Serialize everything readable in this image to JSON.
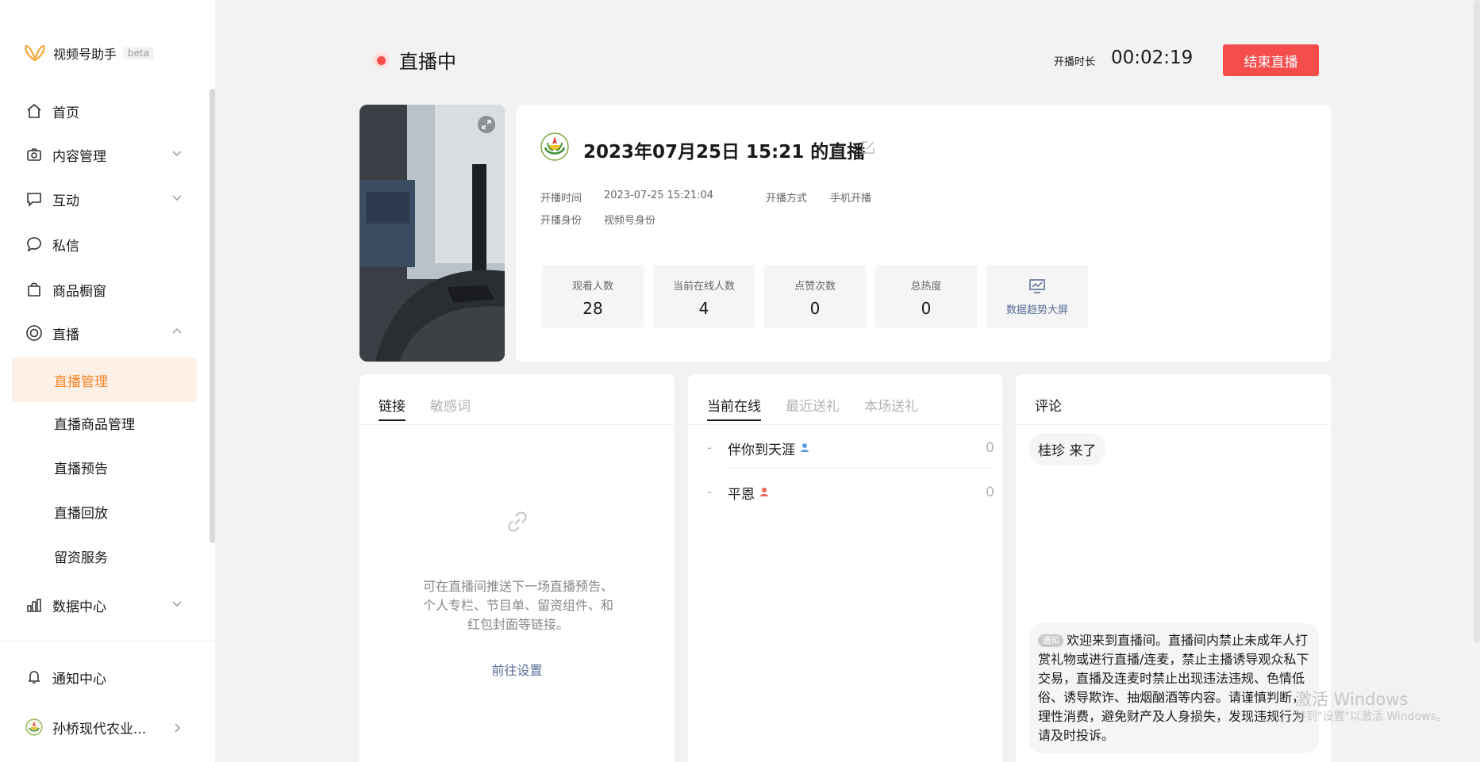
{
  "sidebar": {
    "brand_name": "视频号助手",
    "brand_badge": "beta",
    "items": [
      {
        "label": "首页",
        "icon": "home-icon"
      },
      {
        "label": "内容管理",
        "icon": "camera-icon"
      },
      {
        "label": "互动",
        "icon": "comment-icon"
      },
      {
        "label": "私信",
        "icon": "message-icon"
      },
      {
        "label": "商品橱窗",
        "icon": "bag-icon"
      },
      {
        "label": "直播",
        "icon": "live-icon"
      },
      {
        "label": "数据中心",
        "icon": "chart-icon"
      }
    ],
    "live_sub": [
      "直播管理",
      "直播商品管理",
      "直播预告",
      "直播回放",
      "留资服务"
    ],
    "notify_label": "通知中心",
    "account_label": "孙桥现代农业..."
  },
  "header": {
    "status": "直播中",
    "duration_label": "开播时长",
    "duration_value": "00:02:19",
    "end_button": "结束直播"
  },
  "info": {
    "title": "2023年07月25日 15:21 的直播",
    "start_time_label": "开播时间",
    "start_time": "2023-07-25 15:21:04",
    "method_label": "开播方式",
    "method": "手机开播",
    "identity_label": "开播身份",
    "identity": "视频号身份",
    "stats": [
      {
        "label": "观看人数",
        "value": "28"
      },
      {
        "label": "当前在线人数",
        "value": "4"
      },
      {
        "label": "点赞次数",
        "value": "0"
      },
      {
        "label": "总热度",
        "value": "0"
      }
    ],
    "trend_label": "数据趋势大屏"
  },
  "links_panel": {
    "tabs": [
      "链接",
      "敏感词"
    ],
    "empty_text": "可在直播间推送下一场直播预告、个人专栏、节目单、留资组件、和红包封面等链接。",
    "setup_link": "前往设置"
  },
  "online_panel": {
    "tabs": [
      "当前在线",
      "最近送礼",
      "本场送礼"
    ],
    "rows": [
      {
        "dash": "-",
        "name": "伴你到天涯",
        "value": "0",
        "gender_color": "#5aa0e0"
      },
      {
        "dash": "-",
        "name": "平恩",
        "value": "0",
        "gender_color": "#f0605a"
      }
    ]
  },
  "comment_panel": {
    "title": "评论",
    "comment": "桂珍  来了",
    "notice_tag": "通知",
    "notice_text": "欢迎来到直播间。直播间内禁止未成年人打赏礼物或进行直播/连麦，禁止主播诱导观众私下交易，直播及连麦时禁止出现违法违规、色情低俗、诱导欺诈、抽烟酗酒等内容。请谨慎判断，理性消费，避免财产及人身损失，发现违规行为请及时投诉。"
  },
  "watermark": {
    "line1": "激活 Windows",
    "line2": "转到\"设置\"以激活 Windows。"
  },
  "colors": {
    "accent": "#f4852a",
    "danger": "#f54c4c",
    "link": "#576b95"
  }
}
